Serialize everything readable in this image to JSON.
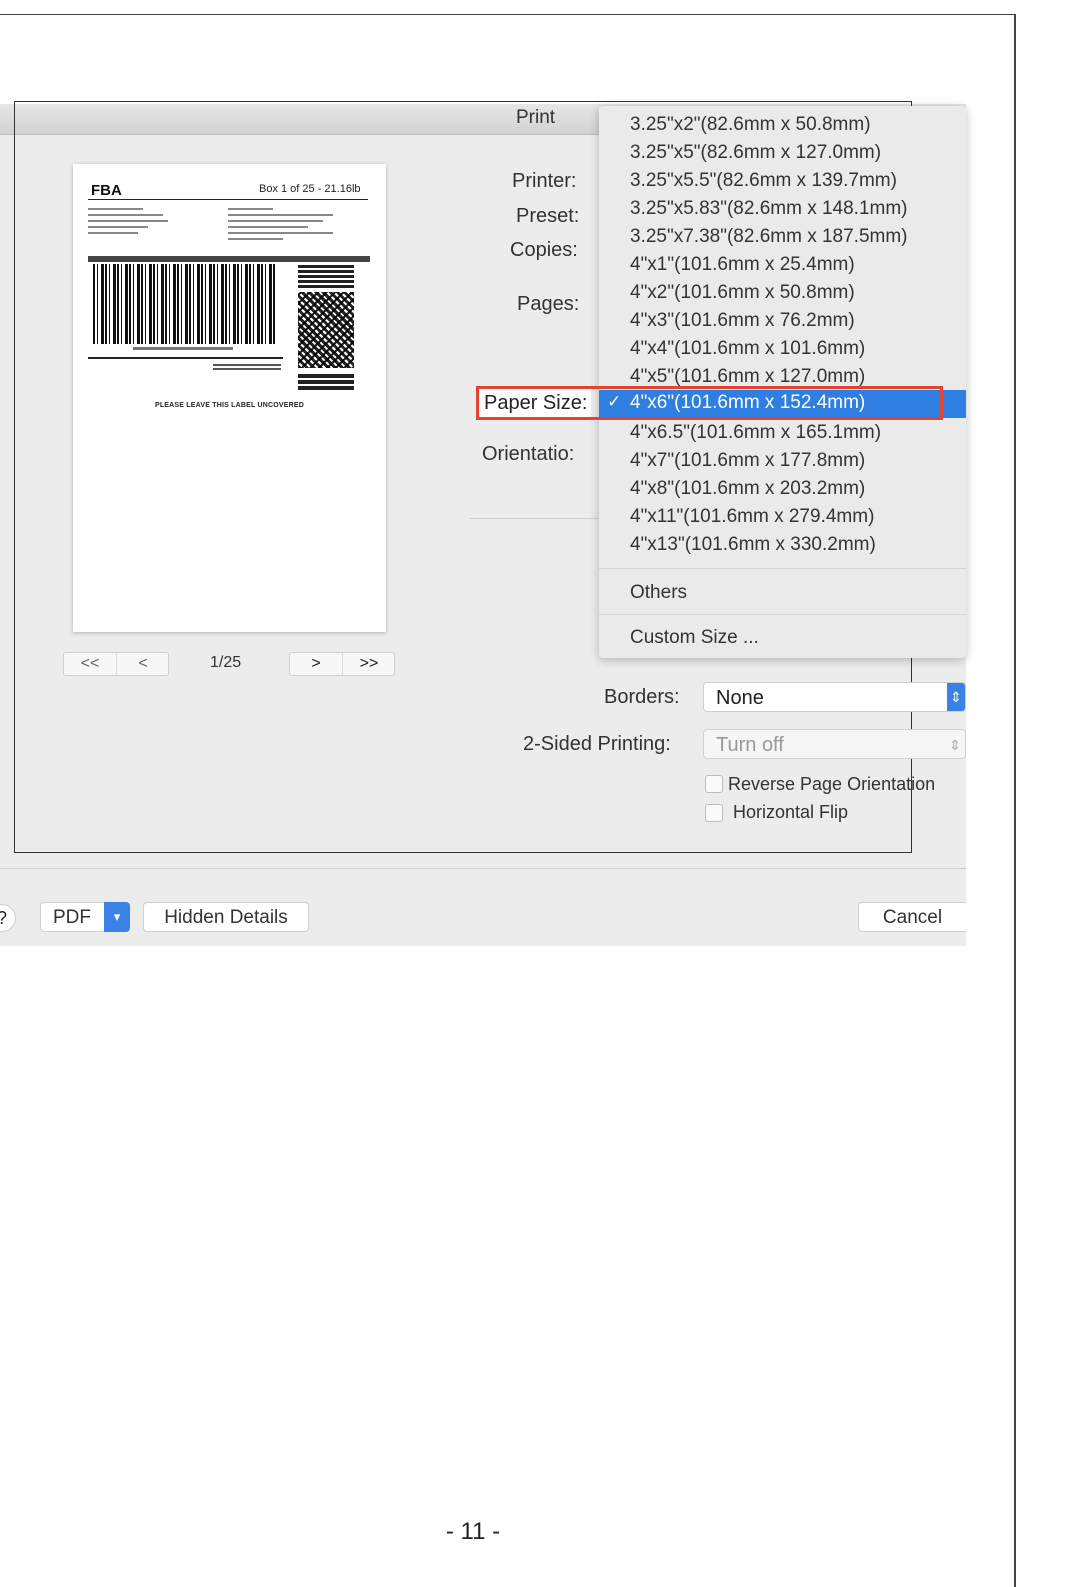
{
  "dialog": {
    "title": "Print",
    "labels": {
      "printer": "Printer:",
      "preset": "Preset:",
      "copies": "Copies:",
      "pages": "Pages:",
      "paper_size": "Paper Size:",
      "orientation": "Orientatio:",
      "borders": "Borders:",
      "two_sided": "2-Sided Printing:"
    }
  },
  "preview": {
    "label_brand": "FBA",
    "label_box_info": "Box 1 of 25 - 21.16lb",
    "label_footer": "PLEASE LEAVE THIS LABEL UNCOVERED",
    "pager": {
      "first": "<<",
      "prev": "<",
      "current": "1/25",
      "next": ">",
      "last": ">>"
    }
  },
  "paper_size_menu": {
    "items": [
      "3.25\"x2\"(82.6mm x 50.8mm)",
      "3.25\"x5\"(82.6mm x 127.0mm)",
      "3.25\"x5.5\"(82.6mm x 139.7mm)",
      "3.25\"x5.83\"(82.6mm x 148.1mm)",
      "3.25\"x7.38\"(82.6mm x 187.5mm)",
      "4\"x1\"(101.6mm x 25.4mm)",
      "4\"x2\"(101.6mm x 50.8mm)",
      "4\"x3\"(101.6mm x 76.2mm)",
      "4\"x4\"(101.6mm x 101.6mm)",
      "4\"x5\"(101.6mm x 127.0mm)",
      "4\"x6\"(101.6mm x 152.4mm)",
      "4\"x6.5\"(101.6mm x 165.1mm)",
      "4\"x7\"(101.6mm x 177.8mm)",
      "4\"x8\"(101.6mm x 203.2mm)",
      "4\"x11\"(101.6mm x 279.4mm)",
      "4\"x13\"(101.6mm x 330.2mm)"
    ],
    "selected": "4\"x6\"(101.6mm x 152.4mm)",
    "check_mark": "✓",
    "others": "Others",
    "custom_size": "Custom Size ..."
  },
  "controls": {
    "borders_value": "None",
    "two_sided_value": "Turn off",
    "reverse_orientation": "Reverse Page Orientation",
    "horizontal_flip": "Horizontal Flip"
  },
  "footer": {
    "help": "?",
    "pdf": "PDF",
    "hidden_details": "Hidden Details",
    "cancel": "Cancel"
  },
  "page_number": "- 11 -",
  "colors": {
    "highlight": "#2f7fe3",
    "annotation_red": "#e0462f"
  }
}
